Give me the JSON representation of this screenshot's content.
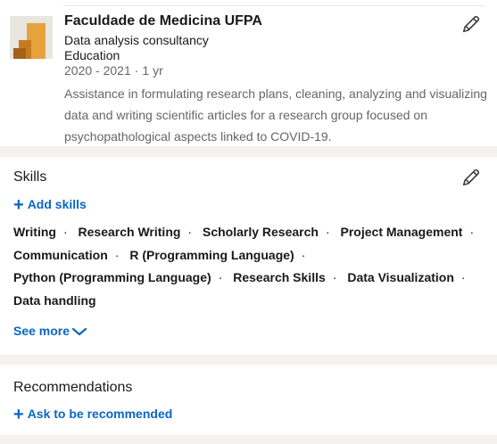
{
  "experience": {
    "organization": "Faculdade de Medicina UFPA",
    "role": "Data analysis consultancy",
    "type": "Education",
    "dates": "2020 - 2021",
    "dot": "·",
    "duration": "1 yr",
    "description": "Assistance in formulating research plans, cleaning, analyzing and visualizing data and writing scientific articles for a research group focused on psychopathological aspects linked to COVID-19.",
    "logo_colors": [
      "#e6a23c",
      "#c7791f",
      "#a5611a"
    ]
  },
  "skills": {
    "title": "Skills",
    "add_label": "Add skills",
    "items": [
      "Writing",
      "Research Writing",
      "Scholarly Research",
      "Project Management",
      "Communication",
      "R (Programming Language)",
      "Python (Programming Language)",
      "Research Skills",
      "Data Visualization",
      "Data handling"
    ],
    "separator": "·",
    "see_more_label": "See more"
  },
  "recommendations": {
    "title": "Recommendations",
    "ask_label": "Ask to be recommended"
  },
  "icons": {
    "edit": "pencil-icon",
    "add": "plus-icon",
    "expand": "chevron-down-icon"
  },
  "colors": {
    "link": "#0a66c2",
    "text": "#191919",
    "muted": "#666666",
    "background": "#f3f2ef"
  }
}
